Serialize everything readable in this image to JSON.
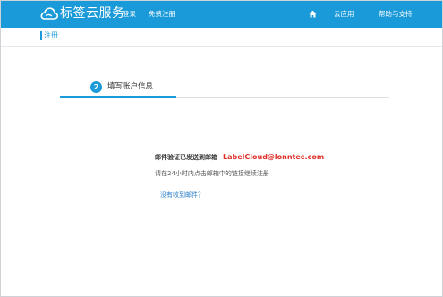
{
  "header": {
    "brand": "标签云服务",
    "nav_left": {
      "login_label": "登录",
      "register_label": "免费注册"
    },
    "nav_right": {
      "home_icon": "home-icon",
      "cloud_apps_label": "云应用",
      "help_label": "帮助与支持"
    }
  },
  "subheader": {
    "title": "注册"
  },
  "step": {
    "number": "2",
    "label": "填写账户信息"
  },
  "message": {
    "email_prefix": "邮件验证已发送到邮箱",
    "email_address": "LabelCloud@lonntec.com",
    "instruction": "请在24小时内点击邮箱中的链接继续注册",
    "resend_link": "没有收到邮件？"
  },
  "colors": {
    "header_bg": "#1a9ad8",
    "accent": "#1a9ad8",
    "email_highlight": "#e0322b",
    "link": "#2a7fc9"
  }
}
